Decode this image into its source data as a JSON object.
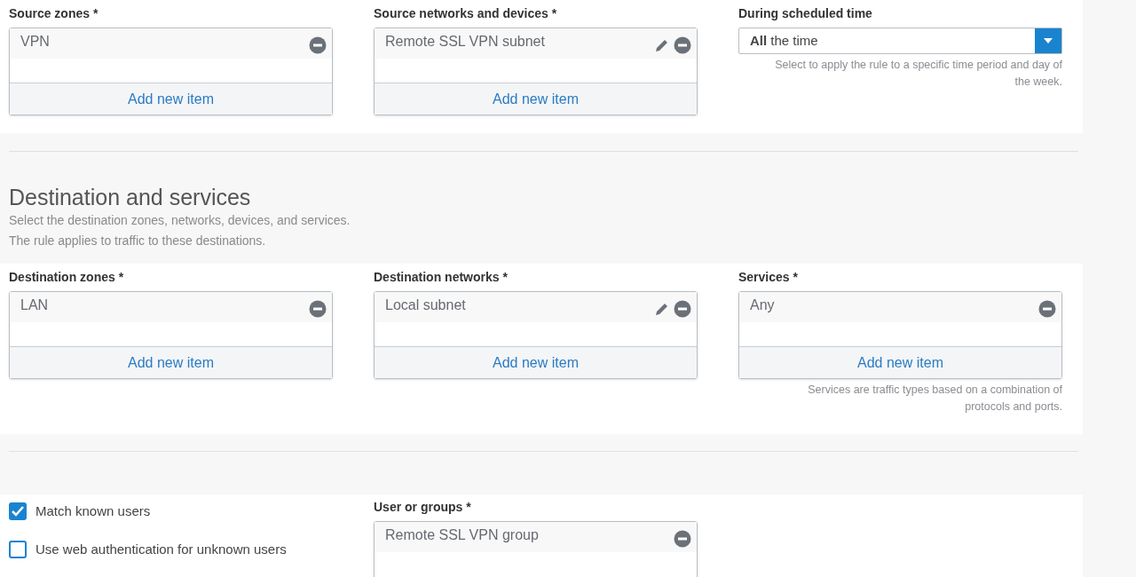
{
  "source": {
    "fields": [
      {
        "kind": "list",
        "label": "Source zones *",
        "items": [
          {
            "text": "VPN",
            "editable": false
          }
        ],
        "add_label": "Add new item"
      },
      {
        "kind": "list",
        "label": "Source networks and devices *",
        "items": [
          {
            "text": "Remote SSL VPN subnet",
            "editable": true
          }
        ],
        "add_label": "Add new item"
      },
      {
        "kind": "select",
        "label": "During scheduled time",
        "value": "**All** the time",
        "hint": "Select to apply the rule to a specific time period and day of the week."
      }
    ]
  },
  "destination": {
    "title": "Destination and services",
    "descriptions": [
      "Select the destination zones, networks, devices, and services.",
      "The rule applies to traffic to these destinations."
    ],
    "fields": [
      {
        "kind": "list",
        "label": "Destination zones *",
        "items": [
          {
            "text": "LAN",
            "editable": false
          }
        ],
        "add_label": "Add new item"
      },
      {
        "kind": "list",
        "label": "Destination networks *",
        "items": [
          {
            "text": "Local subnet",
            "editable": true
          }
        ],
        "add_label": "Add new item"
      },
      {
        "kind": "list",
        "label": "Services *",
        "items": [
          {
            "text": "Any",
            "editable": false
          }
        ],
        "add_label": "Add new item",
        "hint": "Services are traffic types based on a combination of protocols and ports."
      }
    ]
  },
  "users": {
    "checkboxes": [
      {
        "label": "Match known users",
        "checked": true
      },
      {
        "label": "Use web authentication for unknown users",
        "checked": false
      }
    ],
    "fields": [
      {
        "kind": "list",
        "label": "User or groups *",
        "items": [
          {
            "text": "Remote SSL VPN group",
            "editable": false
          }
        ]
      }
    ]
  }
}
